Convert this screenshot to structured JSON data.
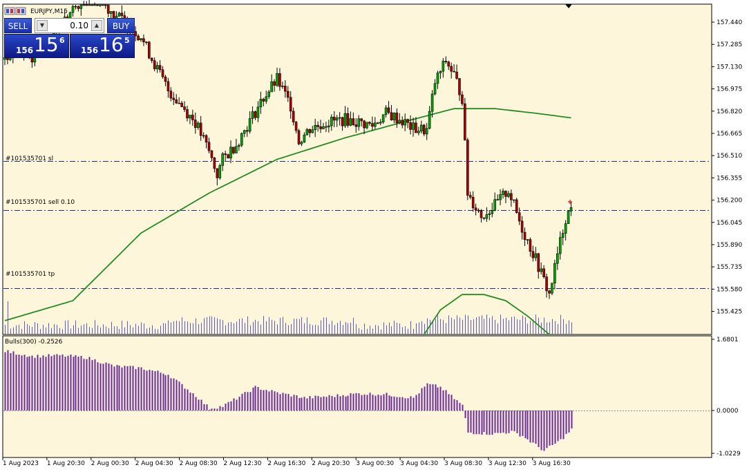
{
  "window": {
    "title": "EURJPY,M15"
  },
  "trade_panel": {
    "sell_label": "SELL",
    "buy_label": "BUY",
    "lot_value": "0.10",
    "sell_price": {
      "prefix": "156",
      "big": "15",
      "sup": "6"
    },
    "buy_price": {
      "prefix": "156",
      "big": "16",
      "sup": "5"
    }
  },
  "colors": {
    "background": "#fdf6da",
    "bull_candle": "#00aa00",
    "bear_candle": "#b00000",
    "ma_line": "#228b22",
    "indicator_bars": "#6a2a9a",
    "order_lines": "#1c2a8c",
    "volume": "#5a5ad0"
  },
  "order_labels": {
    "sl": "#101535701 sl",
    "sell": "#101535701 sell 0.10",
    "tp": "#101535701 tp"
  },
  "indicator": {
    "label": "Bulls(300) -0.2526"
  },
  "price_axis_labels": [
    "157.440",
    "157.285",
    "157.130",
    "156.975",
    "156.820",
    "156.665",
    "156.510",
    "156.355",
    "156.200",
    "156.045",
    "155.890",
    "155.735",
    "155.580",
    "155.425"
  ],
  "indicator_axis_labels": [
    "1.6801",
    "0.0000",
    "-1.0229"
  ],
  "time_labels": [
    "1 Aug 2023",
    "1 Aug 20:30",
    "2 Aug 00:30",
    "2 Aug 04:30",
    "2 Aug 08:30",
    "2 Aug 12:30",
    "2 Aug 16:30",
    "2 Aug 20:30",
    "3 Aug 00:30",
    "3 Aug 04:30",
    "3 Aug 08:30",
    "3 Aug 12:30",
    "3 Aug 16:30"
  ],
  "chart_data": {
    "type": "candlestick",
    "price_axis": {
      "min": 155.36,
      "max": 157.51
    },
    "order_levels": {
      "sl": 156.49,
      "sell": 156.17,
      "tp": 155.66
    },
    "anchors": [
      [
        0,
        157.15
      ],
      [
        5,
        157.22
      ],
      [
        10,
        157.17
      ],
      [
        15,
        157.26
      ],
      [
        20,
        157.37
      ],
      [
        25,
        157.47
      ],
      [
        30,
        157.58
      ],
      [
        35,
        157.53
      ],
      [
        40,
        157.45
      ],
      [
        45,
        157.38
      ],
      [
        50,
        157.3
      ],
      [
        55,
        157.12
      ],
      [
        60,
        156.95
      ],
      [
        65,
        156.85
      ],
      [
        70,
        156.74
      ],
      [
        75,
        156.55
      ],
      [
        78,
        156.4
      ],
      [
        80,
        156.5
      ],
      [
        85,
        156.6
      ],
      [
        90,
        156.75
      ],
      [
        95,
        156.9
      ],
      [
        100,
        157.02
      ],
      [
        105,
        156.85
      ],
      [
        108,
        156.62
      ],
      [
        112,
        156.7
      ],
      [
        118,
        156.74
      ],
      [
        125,
        156.76
      ],
      [
        130,
        156.74
      ],
      [
        135,
        156.72
      ],
      [
        140,
        156.8
      ],
      [
        145,
        156.76
      ],
      [
        150,
        156.7
      ],
      [
        155,
        156.69
      ],
      [
        158,
        157.0
      ],
      [
        162,
        157.14
      ],
      [
        165,
        157.05
      ],
      [
        168,
        156.9
      ],
      [
        170,
        156.28
      ],
      [
        175,
        156.13
      ],
      [
        180,
        156.2
      ],
      [
        185,
        156.3
      ],
      [
        190,
        156.05
      ],
      [
        195,
        155.85
      ],
      [
        200,
        155.62
      ],
      [
        203,
        155.88
      ],
      [
        206,
        156.12
      ],
      [
        208,
        156.18
      ]
    ],
    "ma_points": [
      [
        0,
        155.45
      ],
      [
        25,
        155.58
      ],
      [
        50,
        156.02
      ],
      [
        75,
        156.28
      ],
      [
        100,
        156.5
      ],
      [
        125,
        156.64
      ],
      [
        150,
        156.76
      ],
      [
        165,
        156.83
      ],
      [
        180,
        156.83
      ],
      [
        195,
        156.8
      ],
      [
        208,
        156.77
      ]
    ],
    "indicator_axis": {
      "min": -1.0229,
      "max": 1.6801
    },
    "indicator_anchors": [
      [
        0,
        1.4
      ],
      [
        10,
        1.28
      ],
      [
        20,
        1.3
      ],
      [
        30,
        1.25
      ],
      [
        40,
        1.05
      ],
      [
        50,
        1.0
      ],
      [
        60,
        0.85
      ],
      [
        70,
        0.35
      ],
      [
        75,
        0.05
      ],
      [
        80,
        0.1
      ],
      [
        88,
        0.4
      ],
      [
        92,
        0.55
      ],
      [
        100,
        0.42
      ],
      [
        110,
        0.3
      ],
      [
        120,
        0.34
      ],
      [
        130,
        0.4
      ],
      [
        140,
        0.38
      ],
      [
        150,
        0.3
      ],
      [
        155,
        0.62
      ],
      [
        160,
        0.55
      ],
      [
        168,
        0.12
      ],
      [
        170,
        -0.52
      ],
      [
        180,
        -0.55
      ],
      [
        186,
        -0.5
      ],
      [
        190,
        -0.6
      ],
      [
        198,
        -0.95
      ],
      [
        204,
        -0.7
      ],
      [
        208,
        -0.45
      ]
    ]
  }
}
